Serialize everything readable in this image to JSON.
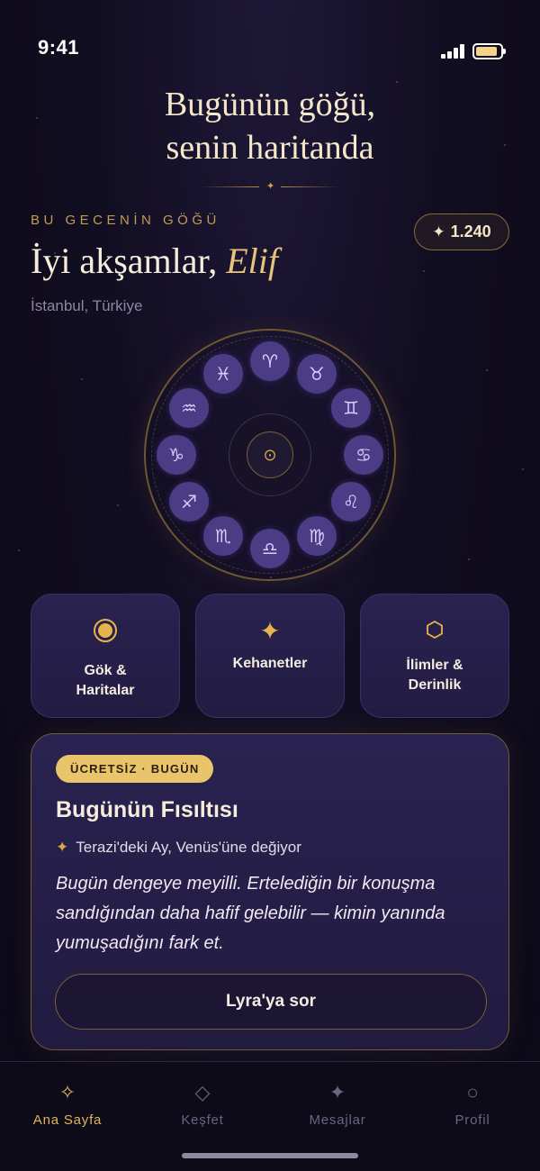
{
  "status_bar": {
    "time": "9:41",
    "signal_icon": "cellular-signal-icon",
    "battery_icon": "battery-icon"
  },
  "hero": {
    "title_line1": "Bugünün göğü,",
    "title_line2": "senin haritanda",
    "divider_icon": "sparkle-icon"
  },
  "greeting": {
    "eyebrow": "BU GECENİN GÖĞÜ",
    "salutation": "İyi akşamlar,",
    "name": "Elif",
    "location": "İstanbul, Türkiye"
  },
  "credits": {
    "icon": "sparkle-icon",
    "value": "1.240"
  },
  "zodiac_wheel": {
    "center_icon": "sun-icon",
    "center_symbol": "⊙",
    "signs": [
      {
        "name": "aries",
        "symbol": "♈"
      },
      {
        "name": "taurus",
        "symbol": "♉"
      },
      {
        "name": "gemini",
        "symbol": "♊"
      },
      {
        "name": "cancer",
        "symbol": "♋"
      },
      {
        "name": "leo",
        "symbol": "♌"
      },
      {
        "name": "virgo",
        "symbol": "♍"
      },
      {
        "name": "libra",
        "symbol": "♎"
      },
      {
        "name": "scorpio",
        "symbol": "♏"
      },
      {
        "name": "sagittarius",
        "symbol": "♐"
      },
      {
        "name": "capricorn",
        "symbol": "♑"
      },
      {
        "name": "aquarius",
        "symbol": "♒"
      },
      {
        "name": "pisces",
        "symbol": "♓"
      }
    ]
  },
  "features": [
    {
      "label_line1": "Gök &",
      "label_line2": "Haritalar",
      "icon": "orb-icon"
    },
    {
      "label_line1": "Kehanetler",
      "label_line2": "",
      "icon": "four-point-star-icon"
    },
    {
      "label_line1": "İlimler &",
      "label_line2": "Derinlik",
      "icon": "hexagon-icon"
    }
  ],
  "daily_whisper": {
    "badge": "ÜCRETSİZ · BUGÜN",
    "title": "Bugünün Fısıltısı",
    "transit": "Terazi'deki Ay, Venüs'üne değiyor",
    "transit_icon": "sparkle-icon",
    "body": "Bugün dengeye meyilli. Ertelediğin bir konuşma sandığından daha hafif gelebilir — kimin yanında yumuşadığını fark et.",
    "cta": "Lyra'ya sor"
  },
  "tabbar": {
    "items": [
      {
        "label": "Ana Sayfa",
        "icon": "sparkle-outline-icon",
        "active": true
      },
      {
        "label": "Keşfet",
        "icon": "diamond-outline-icon",
        "active": false
      },
      {
        "label": "Mesajlar",
        "icon": "four-point-star-icon",
        "active": false
      },
      {
        "label": "Profil",
        "icon": "circle-outline-icon",
        "active": false
      }
    ]
  },
  "colors": {
    "accent_gold": "#e0b35c",
    "badge_gold": "#e9c46a",
    "sign_purple": "#4a3d86",
    "background": "#120e22"
  }
}
